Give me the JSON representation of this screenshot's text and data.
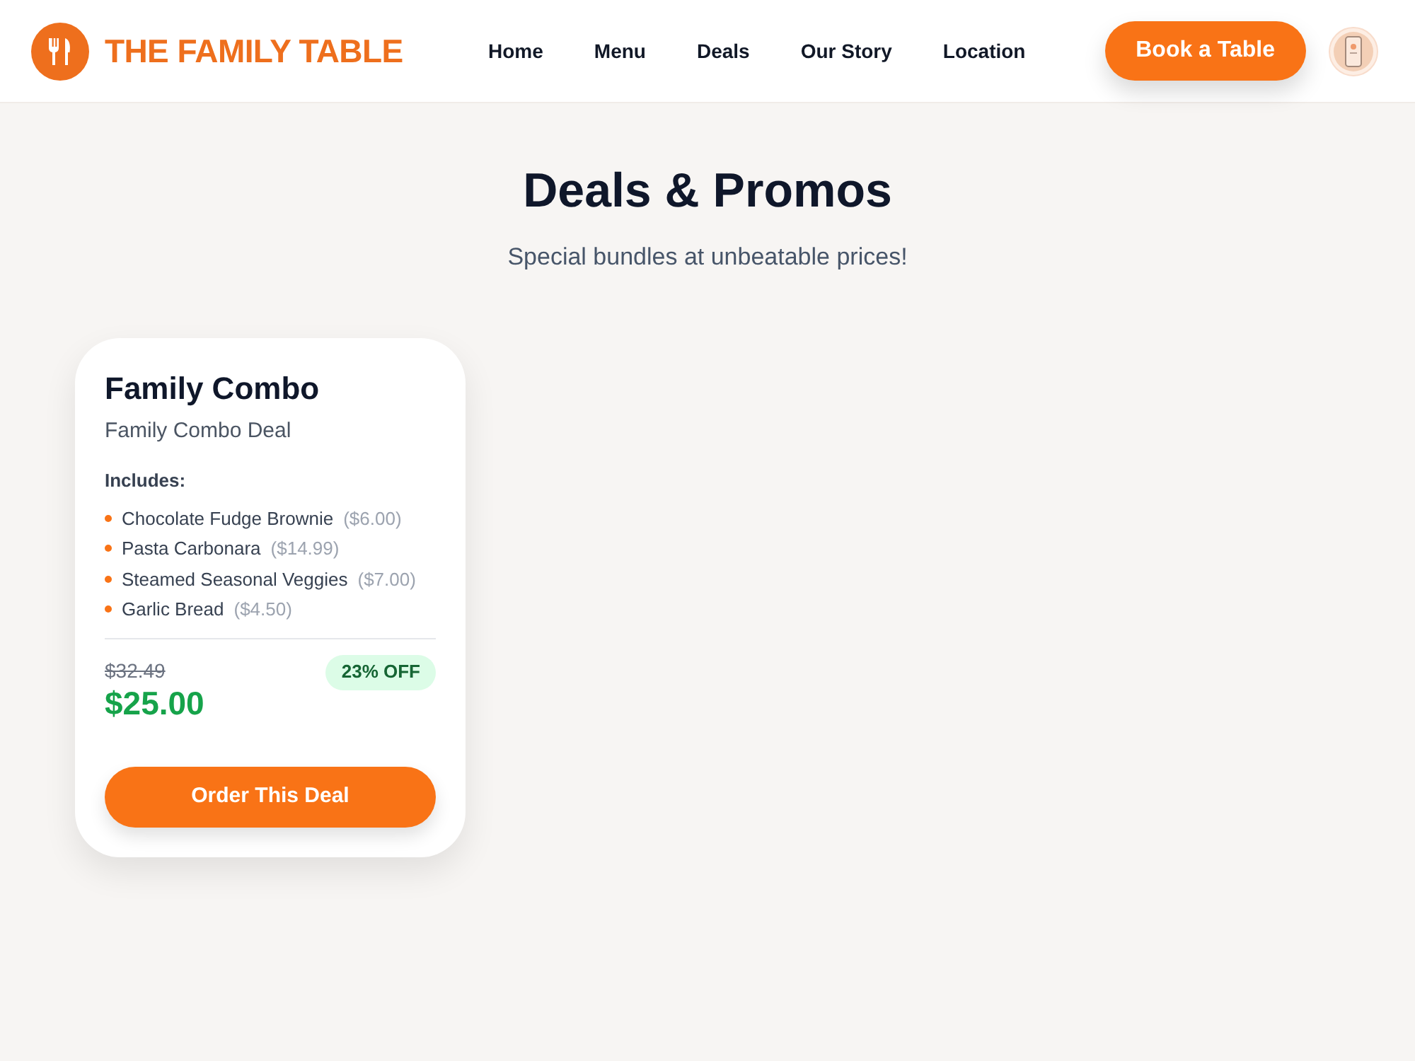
{
  "header": {
    "brand": "THE FAMILY TABLE",
    "nav": [
      "Home",
      "Menu",
      "Deals",
      "Our Story",
      "Location"
    ],
    "cta": "Book a Table"
  },
  "hero": {
    "title": "Deals & Promos",
    "subtitle": "Special bundles at unbeatable prices!"
  },
  "deals": [
    {
      "title": "Family Combo",
      "description": "Family Combo Deal",
      "includes_label": "Includes:",
      "items": [
        {
          "name": "Chocolate Fudge Brownie",
          "price": "($6.00)"
        },
        {
          "name": "Pasta Carbonara",
          "price": "($14.99)"
        },
        {
          "name": "Steamed Seasonal Veggies",
          "price": "($7.00)"
        },
        {
          "name": "Garlic Bread",
          "price": "($4.50)"
        }
      ],
      "original_price": "$32.49",
      "price": "$25.00",
      "discount": "23% OFF",
      "button": "Order This Deal"
    }
  ]
}
